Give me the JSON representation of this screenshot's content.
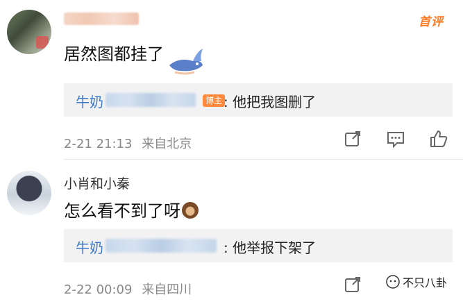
{
  "comments": [
    {
      "badge": "首评",
      "text": "居然图都挂了",
      "reply": {
        "name": "牛奶",
        "tag": "博主",
        "text": ": 他把我图删了"
      },
      "time": "2-21 21:13",
      "source": "来自北京"
    },
    {
      "author": "小肖和小秦",
      "text": "怎么看不到了呀",
      "reply": {
        "name": "牛奶",
        "text": ": 他举报下架了"
      },
      "time": "2-22 00:09",
      "source": "来自四川"
    }
  ],
  "watermark": {
    "text": "不只八卦"
  },
  "icons": [
    "share-icon",
    "comment-icon",
    "like-icon",
    "sticker-whale",
    "see-no-evil-monkey-emoji"
  ],
  "colors": {
    "link": "#3a78c9",
    "badge": "#ff7a21",
    "meta": "#888888",
    "reply_bg": "#f2f2f2"
  }
}
